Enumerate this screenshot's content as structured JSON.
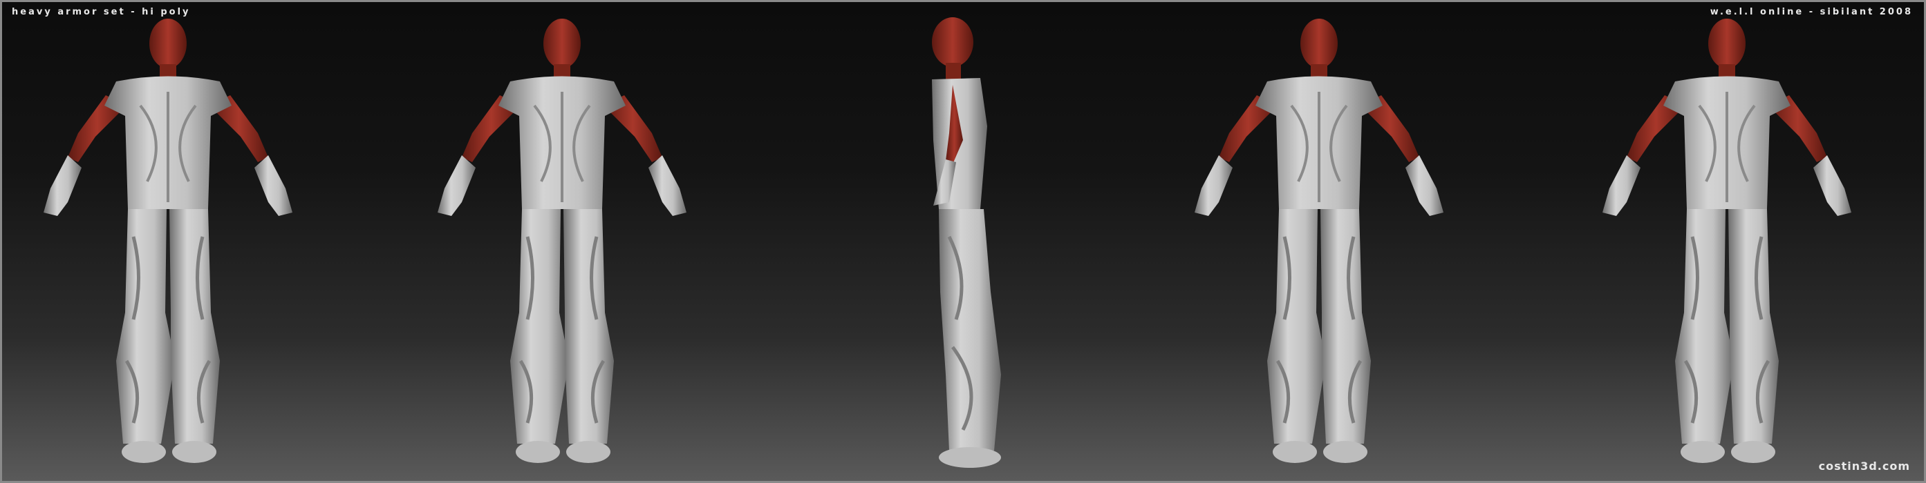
{
  "header": {
    "title": "heavy armor set - hi poly",
    "credit": "w.e.l.l online - sibilant 2008"
  },
  "footer": {
    "site": "costin3d.com"
  },
  "figures": [
    {
      "view": "front",
      "icon": "armor-figure-front"
    },
    {
      "view": "three-quarter front",
      "icon": "armor-figure-three-quarter"
    },
    {
      "view": "side",
      "icon": "armor-figure-side"
    },
    {
      "view": "three-quarter back",
      "icon": "armor-figure-three-quarter-back"
    },
    {
      "view": "back",
      "icon": "armor-figure-back"
    }
  ],
  "colors": {
    "skin": "#9e3324",
    "armor": "#c8c8c8",
    "armor_shadow": "#7a7a7a"
  }
}
